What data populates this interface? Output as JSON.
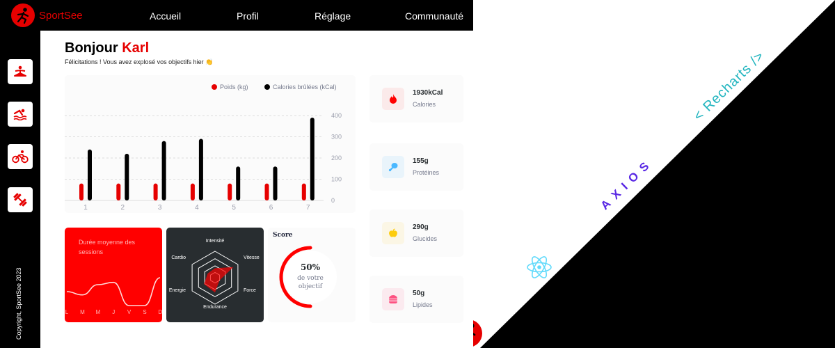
{
  "app": {
    "name": "SportSee"
  },
  "nav": [
    {
      "label": "Accueil"
    },
    {
      "label": "Profil"
    },
    {
      "label": "Réglage"
    },
    {
      "label": "Communauté"
    }
  ],
  "sidebar": {
    "icons": [
      "yoga-icon",
      "swimming-icon",
      "cycling-icon",
      "dumbbell-icon"
    ],
    "copyright": "Copyright, SportSee 2023"
  },
  "greeting": {
    "hello": "Bonjour",
    "name": "Karl",
    "message": "Félicitations ! Vous avez explosé vos objectifs hier 👏"
  },
  "colors": {
    "accent": "#e60000",
    "black": "#000000",
    "dark": "#282d30"
  },
  "activity": {
    "chart_data": {
      "type": "bar",
      "categories": [
        "1",
        "2",
        "3",
        "4",
        "5",
        "6",
        "7"
      ],
      "series": [
        {
          "name": "Poids (kg)",
          "values": [
            80,
            80,
            80,
            80,
            80,
            80,
            80
          ],
          "color": "#e60000"
        },
        {
          "name": "Calories brûlées (kCal)",
          "values": [
            240,
            220,
            280,
            290,
            160,
            160,
            390
          ],
          "color": "#000000"
        }
      ],
      "yticks": [
        0,
        100,
        200,
        300,
        400
      ],
      "ylim": [
        0,
        400
      ],
      "legend": "top-right",
      "grid": true
    }
  },
  "sessions": {
    "title": "Durée moyenne des sessions",
    "chart_data": {
      "type": "line",
      "categories": [
        "L",
        "M",
        "M",
        "J",
        "V",
        "S",
        "D"
      ],
      "values": [
        30,
        23,
        45,
        50,
        0,
        0,
        60
      ],
      "color": "#ffffff"
    }
  },
  "performance": {
    "chart_data": {
      "type": "radar",
      "axes": [
        "Intensité",
        "Vitesse",
        "Force",
        "Endurance",
        "Energie",
        "Cardio"
      ],
      "values": [
        90,
        200,
        50,
        140,
        120,
        80
      ],
      "max": 250,
      "color": "#ff0101"
    }
  },
  "score": {
    "label": "Score",
    "percent_text": "50%",
    "line1": "de votre",
    "line2": "objectif",
    "chart_data": {
      "type": "radial",
      "value": 0.5
    }
  },
  "key_data": [
    {
      "value": "1930kCal",
      "label": "Calories",
      "icon": "fire-icon",
      "bg": "#fbeaea",
      "color": "#ff0000"
    },
    {
      "value": "155g",
      "label": "Protéines",
      "icon": "chicken-icon",
      "bg": "#e9f4fb",
      "color": "#4ab8ff"
    },
    {
      "value": "290g",
      "label": "Glucides",
      "icon": "apple-icon",
      "bg": "#fbf6e5",
      "color": "#fdcc0c"
    },
    {
      "value": "50g",
      "label": "Lipides",
      "icon": "burger-icon",
      "bg": "#fbeaef",
      "color": "#fd5181"
    }
  ],
  "tech": {
    "recharts": "< Recharts />",
    "axios": "AXIOS",
    "react": "react-logo",
    "logo": "sportsee-logo"
  }
}
